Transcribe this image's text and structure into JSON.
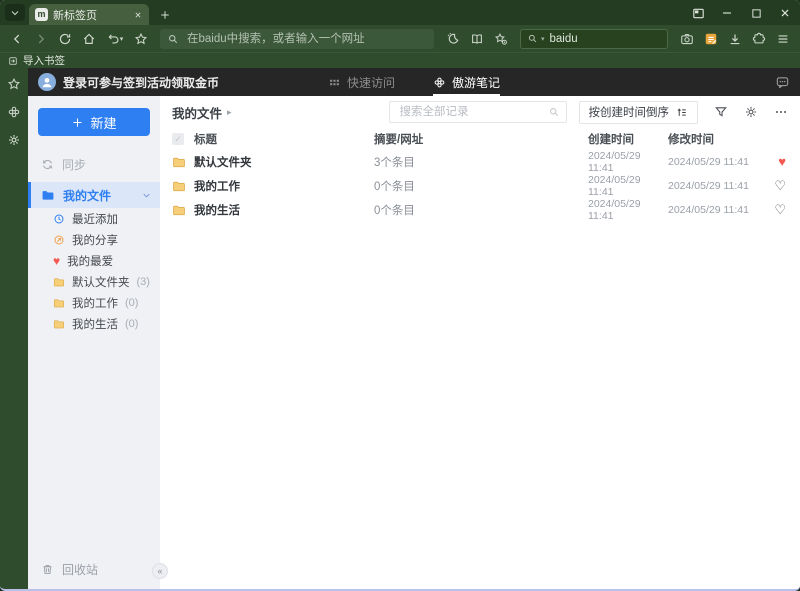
{
  "browser": {
    "tab_title": "新标签页",
    "address_placeholder": "在baidu中搜索，或者输入一个网址",
    "quick_search_value": "baidu",
    "import_bookmarks_label": "导入书签"
  },
  "notes": {
    "header": {
      "login_text": "登录可参与签到活动领取金币",
      "tab_quick_access": "快速访问",
      "tab_notes": "傲游笔记"
    },
    "sidebar": {
      "new_button_label": "新建",
      "sync_label": "同步",
      "my_files_label": "我的文件",
      "items": [
        {
          "label": "最近添加",
          "count": ""
        },
        {
          "label": "我的分享",
          "count": ""
        },
        {
          "label": "我的最爱",
          "count": ""
        },
        {
          "label": "默认文件夹",
          "count": "(3)"
        },
        {
          "label": "我的工作",
          "count": "(0)"
        },
        {
          "label": "我的生活",
          "count": "(0)"
        }
      ],
      "recycle_bin_label": "回收站",
      "collapse_glyph": "«"
    },
    "main": {
      "breadcrumb": "我的文件",
      "breadcrumb_arrow": "▸",
      "search_placeholder": "搜索全部记录",
      "sort_button_label": "按创建时间倒序",
      "header_checkbox_glyph": "✓",
      "columns": {
        "title": "标题",
        "summary": "摘要/网址",
        "created": "创建时间",
        "modified": "修改时间"
      },
      "rows": [
        {
          "title": "默认文件夹",
          "summary": "3个条目",
          "created": "2024/05/29 11:41",
          "modified": "2024/05/29 11:41",
          "favorite": true,
          "fav_glyph": "♥",
          "fav_class": "fav-heart filled"
        },
        {
          "title": "我的工作",
          "summary": "0个条目",
          "created": "2024/05/29 11:41",
          "modified": "2024/05/29 11:41",
          "favorite": false,
          "fav_glyph": "♡",
          "fav_class": "fav-heart outline"
        },
        {
          "title": "我的生活",
          "summary": "0个条目",
          "created": "2024/05/29 11:41",
          "modified": "2024/05/29 11:41",
          "favorite": false,
          "fav_glyph": "♡",
          "fav_class": "fav-heart outline"
        }
      ]
    },
    "icons": {
      "favorite_filled": "♥",
      "favorite_outline": "♡"
    }
  },
  "colors": {
    "theme_green_dark": "#233c22",
    "theme_green": "#2f4c2d",
    "active_tab_green": "#46603f",
    "accent_blue": "#2e7ff2",
    "selected_row_blue": "#dbe7f8",
    "heart_red": "#f5584e",
    "folder_yellow": "#f7cf79",
    "page_header_dark": "#262626",
    "sidebar_gray": "#f0f1f4",
    "window_border": "#b9c0ea"
  }
}
